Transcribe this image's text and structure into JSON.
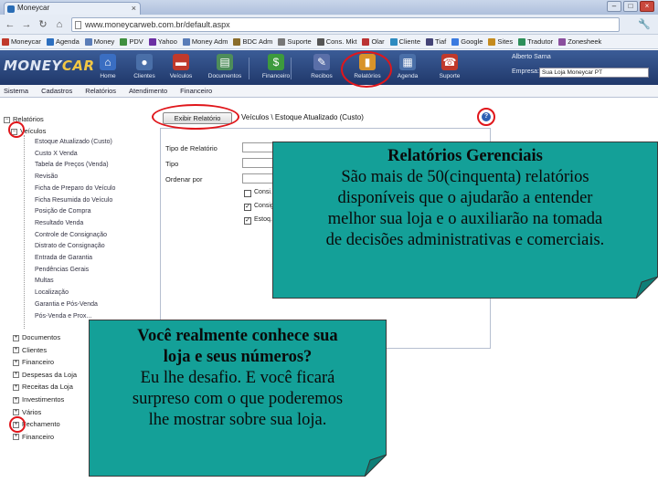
{
  "browser": {
    "tab_title": "Moneycar",
    "tab_close": "×",
    "url": "www.moneycarweb.com.br/default.aspx",
    "back": "←",
    "forward": "→",
    "reload": "↻",
    "home": "⌂",
    "window_buttons": [
      "–",
      "□",
      "×"
    ]
  },
  "bookmarks": [
    {
      "label": "Moneycar",
      "color": "#c0392b"
    },
    {
      "label": "Agenda",
      "color": "#2c6fbf"
    },
    {
      "label": "Money",
      "color": "#5a7db8"
    },
    {
      "label": "PDV",
      "color": "#3f8f3f"
    },
    {
      "label": "Yahoo",
      "color": "#6b2fa3"
    },
    {
      "label": "Money Adm",
      "color": "#5a7db8"
    },
    {
      "label": "BDC Adm",
      "color": "#8a6d2b"
    },
    {
      "label": "Suporte",
      "color": "#777777"
    },
    {
      "label": "Cons. Mkt",
      "color": "#555555"
    },
    {
      "label": "Olar",
      "color": "#b33"
    },
    {
      "label": "Cliente",
      "color": "#2e8bc0"
    },
    {
      "label": "Tiaf",
      "color": "#447"
    },
    {
      "label": "Google",
      "color": "#3b7be0"
    },
    {
      "label": "Sites",
      "color": "#c58b1e"
    },
    {
      "label": "Tradutor",
      "color": "#2d8f5a"
    },
    {
      "label": "Zonesheek",
      "color": "#8a4f9e"
    }
  ],
  "app": {
    "logo_left": "MONEY",
    "logo_right": "CAR",
    "toolbar": [
      {
        "label": "Home",
        "icon": "home-icon",
        "glyph": "⌂",
        "color": "#3a6ec2"
      },
      {
        "label": "Clientes",
        "icon": "person-icon",
        "glyph": "●",
        "color": "#4a6fa8"
      },
      {
        "label": "Veículos",
        "icon": "car-icon",
        "glyph": "▬",
        "color": "#c0392b"
      },
      {
        "label": "Documentos",
        "icon": "document-icon",
        "glyph": "▤",
        "color": "#4e8d5a"
      },
      {
        "label": "Financeiro",
        "icon": "dollar-icon",
        "glyph": "$",
        "color": "#3d9a3d"
      },
      {
        "label": "Recibos",
        "icon": "receipt-icon",
        "glyph": "✎",
        "color": "#5a6fa8"
      },
      {
        "label": "Relatórios",
        "icon": "chart-icon",
        "glyph": "▮",
        "color": "#d8932a"
      },
      {
        "label": "Agenda",
        "icon": "calendar-icon",
        "glyph": "▦",
        "color": "#4a6fa8"
      },
      {
        "label": "Suporte",
        "icon": "phone-icon",
        "glyph": "☎",
        "color": "#c0392b"
      }
    ],
    "user_label": "Alberto Sarna",
    "empresa_label": "Empresa:",
    "empresa_value": "Sua Loja Moneycar PT"
  },
  "menu": [
    "Sistema",
    "Cadastros",
    "Relatórios",
    "Atendimento",
    "Financeiro"
  ],
  "tree": {
    "root": "Relatórios",
    "expanded": "Veículos",
    "vehicle_reports": [
      "Estoque Atualizado (Custo)",
      "Custo X Venda",
      "Tabela de Preços (Venda)",
      "Revisão",
      "Ficha de Preparo do Veículo",
      "Ficha Resumida do Veículo",
      "Posição de Compra",
      "Resultado Venda",
      "Controle de Consignação",
      "Distrato de Consignação",
      "Entrada de Garantia",
      "Pendências Gerais",
      "Multas",
      "Localização",
      "Garantia e Pós-Venda",
      "Pós-Venda e Prox..."
    ],
    "other_nodes": [
      "Documentos",
      "Clientes",
      "Financeiro",
      "Despesas da Loja",
      "Receitas da Loja",
      "Investimentos",
      "Vários",
      "Fechamento",
      "Financeiro"
    ]
  },
  "report": {
    "button": "Exibir Relatório",
    "title": "Veículos \\ Estoque Atualizado (Custo)",
    "help": "?",
    "fields": [
      "Tipo de Relatório",
      "Tipo",
      "Ordenar por"
    ],
    "checks": [
      {
        "label": "Consi...",
        "checked": false
      },
      {
        "label": "Consig...",
        "checked": true
      },
      {
        "label": "Estoq...",
        "checked": true
      }
    ]
  },
  "callouts": {
    "top": {
      "title": "Relatórios Gerenciais",
      "lines": [
        "São mais de 50(cinquenta) relatórios",
        "disponíveis que o ajudarão a entender",
        "melhor sua loja e o auxiliarão na tomada",
        "de decisões administrativas e comerciais."
      ]
    },
    "bottom": {
      "title_lines": [
        "Você realmente conhece sua",
        "loja e seus números?"
      ],
      "lines": [
        "Eu lhe desafio. E você ficará",
        "surpreso com o que poderemos",
        "lhe mostrar sobre sua loja."
      ]
    }
  },
  "colors": {
    "callout": "#14a098",
    "highlight_ring": "#e0161b",
    "header": "#2a4578"
  }
}
